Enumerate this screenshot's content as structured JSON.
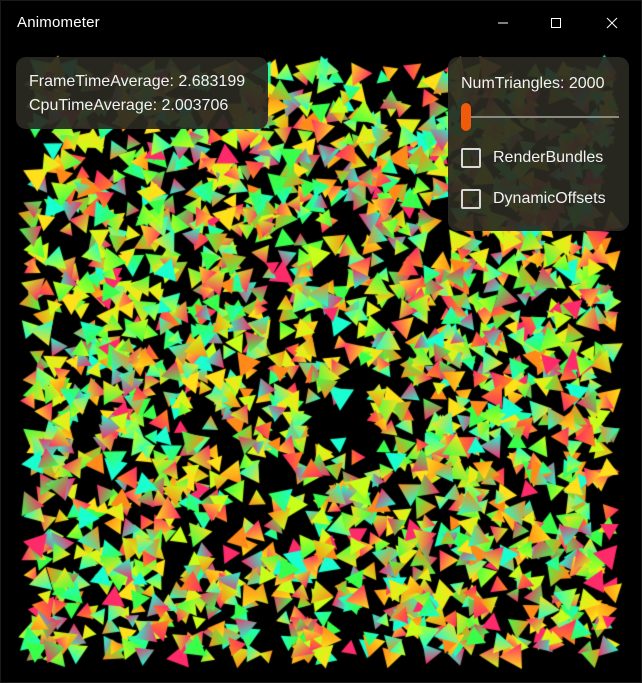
{
  "window": {
    "title": "Animometer"
  },
  "titlebar_buttons": {
    "minimize_icon": "minimize-icon",
    "maximize_icon": "maximize-icon",
    "close_icon": "close-icon"
  },
  "stats": {
    "frame_time_average": "FrameTimeAverage: 2.683199",
    "cpu_time_average": "CpuTimeAverage: 2.003706"
  },
  "settings": {
    "num_triangles_label": "NumTriangles: 2000",
    "num_triangles_slider_fraction": 0.02,
    "slider_accent": "#f05a0a",
    "render_bundles": {
      "label": "RenderBundles",
      "checked": false
    },
    "dynamic_offsets": {
      "label": "DynamicOffsets",
      "checked": false
    }
  },
  "scene": {
    "background": "#000000",
    "triangle_count": 2000,
    "triangle_colors": [
      "#ff2a6a",
      "#ffe01a",
      "#3aff4a",
      "#1affd0",
      "#ff8a1a",
      "#c8ff1a"
    ]
  }
}
